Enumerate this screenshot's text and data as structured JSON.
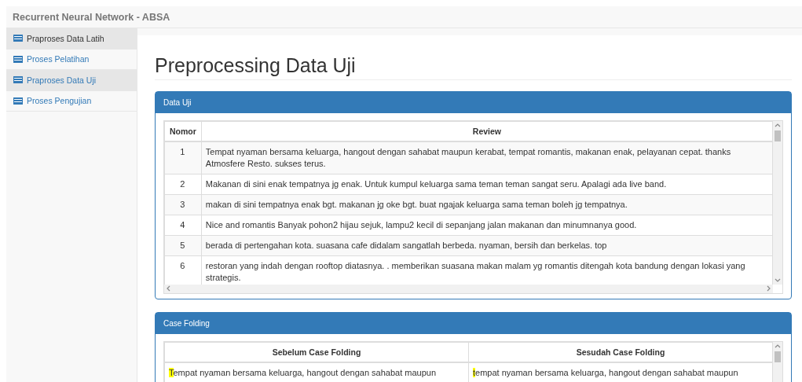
{
  "navbar": {
    "brand": "Recurrent Neural Network - ABSA"
  },
  "sidebar": {
    "items": [
      {
        "label": "Praproses Data Latih",
        "selected": true,
        "highlighted": true
      },
      {
        "label": "Proses Pelatihan",
        "selected": false,
        "highlighted": false
      },
      {
        "label": "Praproses Data Uji",
        "selected": false,
        "highlighted": true
      },
      {
        "label": "Proses Pengujian",
        "selected": false,
        "highlighted": false
      }
    ]
  },
  "page_title": "Preprocessing Data Uji",
  "data_panel": {
    "heading": "Data Uji",
    "columns": [
      "Nomor",
      "Review"
    ],
    "rows": [
      {
        "nomor": "1",
        "review": "Tempat nyaman bersama keluarga, hangout dengan sahabat maupun kerabat, tempat romantis, makanan enak, pelayanan cepat. thanks Atmosfere Resto. sukses terus."
      },
      {
        "nomor": "2",
        "review": "Makanan di sini enak tempatnya jg enak. Untuk kumpul keluarga sama teman teman sangat seru. Apalagi ada live band."
      },
      {
        "nomor": "3",
        "review": "makan di sini tempatnya enak bgt. makanan jg oke bgt. buat ngajak keluarga sama teman boleh jg tempatnya."
      },
      {
        "nomor": "4",
        "review": "Nice and romantis Banyak pohon2 hijau sejuk, lampu2 kecil di sepanjang jalan makanan dan minumnanya good."
      },
      {
        "nomor": "5",
        "review": "berada di pertengahan kota. suasana cafe didalam sangatlah berbeda. nyaman, bersih dan berkelas. top"
      },
      {
        "nomor": "6",
        "review": "restoran yang indah dengan rooftop diatasnya. . memberikan suasana makan malam yg romantis ditengah kota bandung dengan lokasi yang strategis."
      }
    ]
  },
  "case_panel": {
    "heading": "Case Folding",
    "columns": [
      "Sebelum Case Folding",
      "Sesudah Case Folding"
    ],
    "rows": [
      {
        "before": {
          "highlight": "T",
          "rest": "empat nyaman bersama keluarga, hangout dengan sahabat maupun"
        },
        "after": {
          "highlight": "t",
          "rest": "empat nyaman bersama keluarga, hangout dengan sahabat maupun"
        }
      }
    ]
  }
}
